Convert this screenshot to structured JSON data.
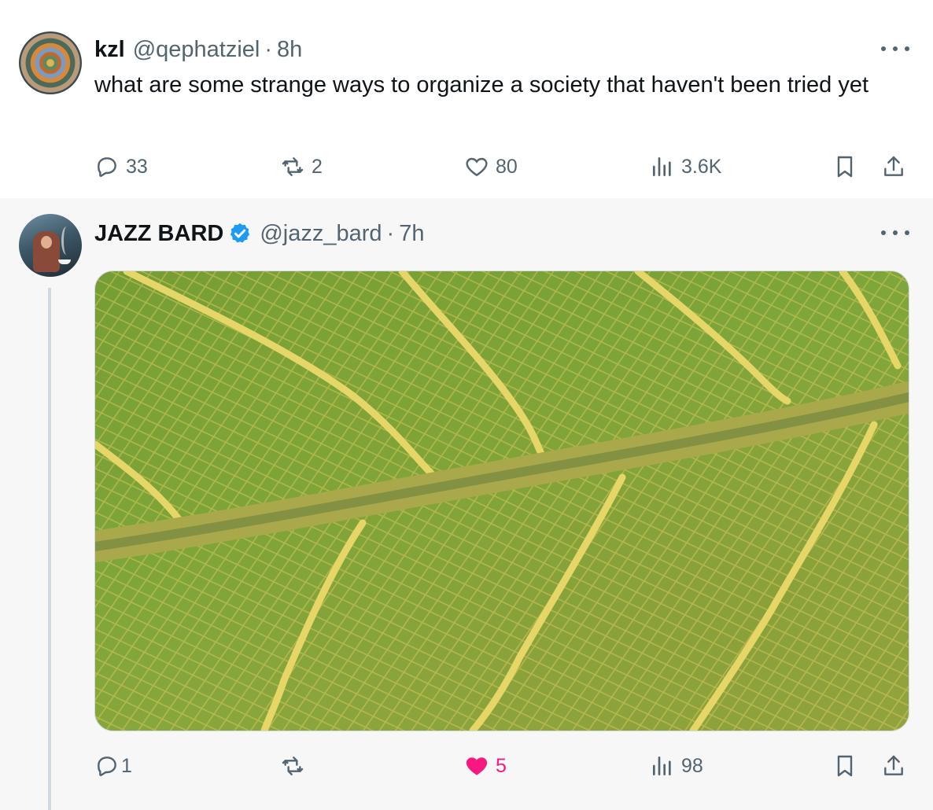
{
  "tweet1": {
    "name": "kzl",
    "handle": "@qephatziel",
    "separator": "·",
    "time": "8h",
    "text": "what are some strange ways to organize a society that haven't been tried yet",
    "replies": "33",
    "reposts": "2",
    "likes": "80",
    "views": "3.6K"
  },
  "tweet2": {
    "name": "JAZZ BARD",
    "handle": "@jazz_bard",
    "separator": "·",
    "time": "7h",
    "image_alt": "close-up of a green leaf showing yellow veins",
    "replies": "1",
    "reposts": "",
    "likes": "5",
    "views": "98",
    "liked": true
  },
  "colors": {
    "accent_like": "#f91880",
    "verified_blue": "#1d9bf0",
    "muted_text": "#536471",
    "thread_line": "#cfd9de"
  },
  "icons": [
    "reply-icon",
    "repost-icon",
    "like-icon",
    "views-icon",
    "bookmark-icon",
    "share-icon",
    "more-icon",
    "verified-badge-icon"
  ]
}
